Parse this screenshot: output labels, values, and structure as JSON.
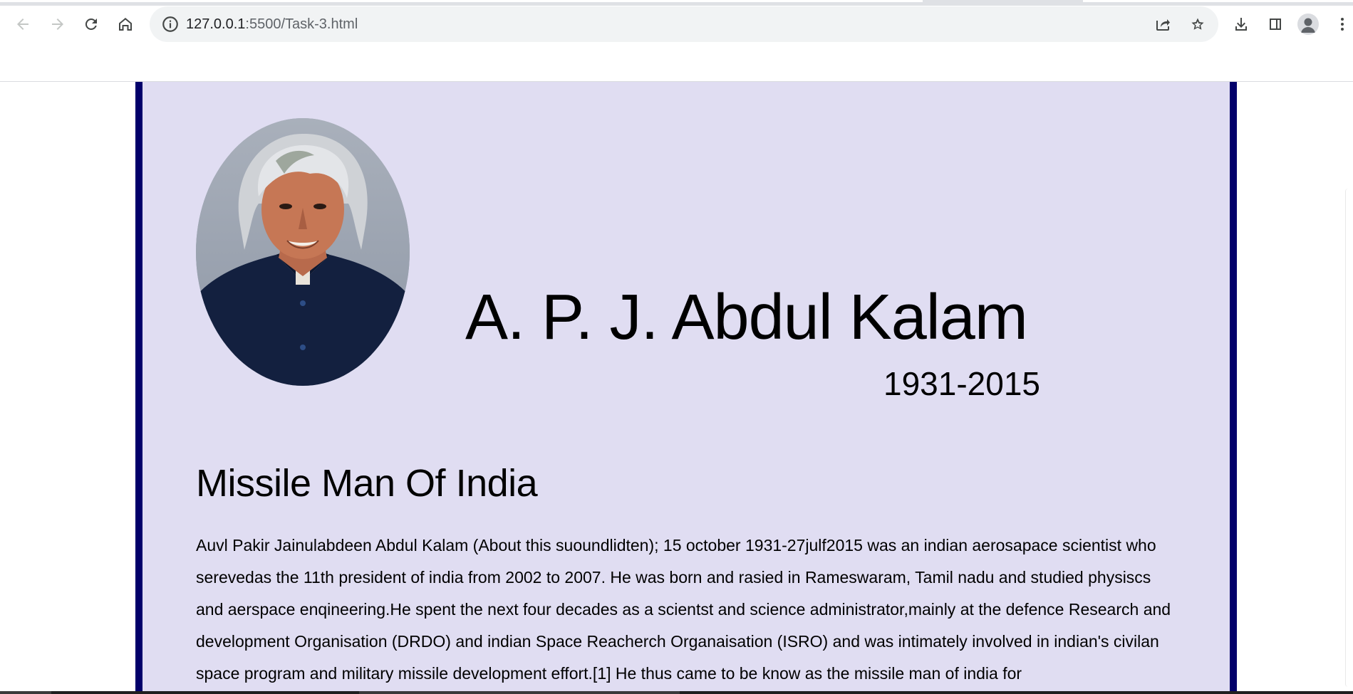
{
  "browser": {
    "url_host": "127.0.0.1",
    "url_path": ":5500/Task-3.html",
    "icons": {
      "back": "arrow-left-icon",
      "forward": "arrow-right-icon",
      "reload": "reload-icon",
      "home": "home-icon",
      "site_info": "info-icon",
      "share": "share-icon",
      "bookmark": "star-icon",
      "downloads": "download-icon",
      "side_panel": "side-panel-icon",
      "profile": "profile-icon",
      "menu": "kebab-menu-icon"
    },
    "colors": {
      "omnibox": "#f1f3f4",
      "icon": "#5f6368"
    }
  },
  "page": {
    "colors": {
      "card_background": "#e0ddf2",
      "card_border": "#02006b"
    },
    "portrait_alt": "A. P. J. Abdul Kalam portrait",
    "name": "A. P. J. Abdul Kalam",
    "years": "1931-2015",
    "section_title": "Missile Man Of India",
    "bio": "Auvl Pakir Jainulabdeen Abdul Kalam (About this suoundlidten); 15 october 1931-27julf2015 was an indian aerosapace scientist who serevedas the 11th president of india from 2002 to 2007. He was born and rasied in Rameswaram, Tamil nadu and studied physiscs and aerspace enqineering.He spent the next four decades as a scientst and science administrator,mainly at the defence Research and development Organisation (DRDO) and indian Space Reacherch Organaisation (ISRO) and was intimately involved in indian's civilan space program and military missile development effort.[1] He thus came to be know as the missile man of india for"
  }
}
